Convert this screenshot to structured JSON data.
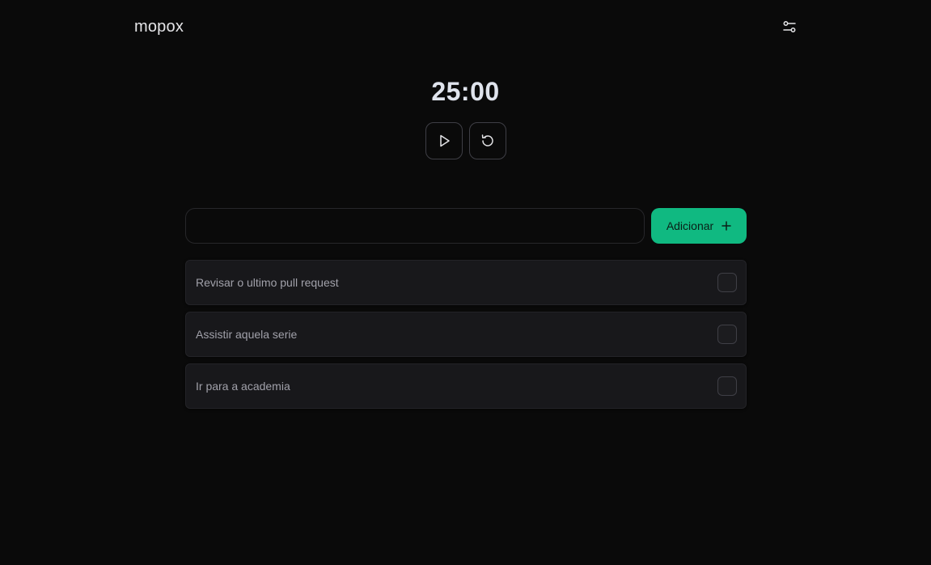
{
  "app": {
    "brand": "mopox"
  },
  "header": {
    "settings_icon": "sliders-icon"
  },
  "timer": {
    "display": "25:00",
    "play_icon": "play-icon",
    "reset_icon": "rotate-ccw-icon"
  },
  "add_task": {
    "input_value": "",
    "input_placeholder": "",
    "button_label": "Adicionar",
    "button_icon": "plus-icon"
  },
  "tasks": [
    {
      "label": "Revisar o ultimo pull request",
      "done": false
    },
    {
      "label": "Assistir aquela serie",
      "done": false
    },
    {
      "label": "Ir para a academia",
      "done": false
    }
  ],
  "colors": {
    "background": "#0a0a0a",
    "accent": "#10b981",
    "card": "#18181b"
  }
}
